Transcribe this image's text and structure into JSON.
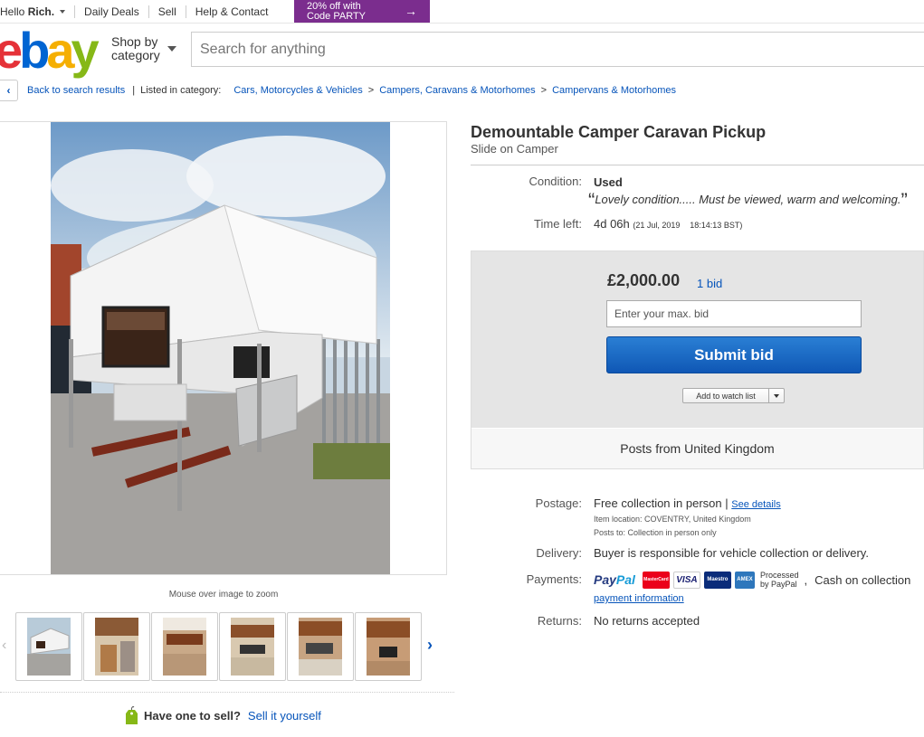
{
  "topbar": {
    "greeting_prefix": "Hello ",
    "user_name": "Rich.",
    "daily_deals": "Daily Deals",
    "sell": "Sell",
    "help": "Help & Contact",
    "promo_line1": "20% off with",
    "promo_line2": "Code PARTY",
    "promo_arrow": "→"
  },
  "header": {
    "logo": {
      "e": "e",
      "b": "b",
      "a": "a",
      "y": "y"
    },
    "shop_by_line1": "Shop by",
    "shop_by_line2": "category",
    "search_placeholder": "Search for anything"
  },
  "breadcrumb": {
    "back_icon": "‹",
    "back_label": "Back to search results",
    "listed_in": "Listed in category:",
    "items": [
      "Cars, Motorcycles & Vehicles",
      "Campers, Caravans & Motorhomes",
      "Campervans & Motorhomes"
    ],
    "separator": ">"
  },
  "gallery": {
    "zoom_note": "Mouse over image to zoom",
    "thumbnail_count": 6
  },
  "sell_prompt": {
    "question": "Have one to sell?",
    "link": "Sell it yourself"
  },
  "listing": {
    "title": "Demountable Camper Caravan Pickup",
    "subtitle": "Slide on Camper",
    "condition_label": "Condition:",
    "condition_value": "Used",
    "condition_quote": "Lovely condition..... Must be viewed, warm and welcoming.",
    "open_quote": "“",
    "close_quote": "”",
    "time_left_label": "Time left:",
    "time_left_value": "4d 06h",
    "end_date": "(21 Jul, 2019",
    "end_time": "18:14:13 BST)"
  },
  "bid": {
    "price": "£2,000.00",
    "bid_count": "1 bid",
    "max_bid_placeholder": "Enter your max. bid",
    "submit": "Submit bid",
    "watch": "Add to watch list",
    "posts_from": "Posts from United Kingdom"
  },
  "details": {
    "postage_label": "Postage:",
    "postage_value": "Free collection in person",
    "postage_sep": "|",
    "see_details": "See details",
    "item_location": "Item location:  COVENTRY, United Kingdom",
    "posts_to": "Posts to:  Collection in person only",
    "delivery_label": "Delivery:",
    "delivery_value": "Buyer is responsible for vehicle collection or delivery.",
    "payments_label": "Payments:",
    "paypal_1": "Pay",
    "paypal_2": "Pal",
    "card_mastercard": "MasterCard",
    "card_visa": "VISA",
    "card_maestro": "Maestro",
    "card_amex": "AMEX",
    "processed_1": "Processed",
    "processed_2": "by PayPal",
    "comma": ",",
    "cash": "Cash on collection",
    "payment_info": "payment information",
    "returns_label": "Returns:",
    "returns_value": "No returns accepted"
  },
  "colors": {
    "ebay_red": "#e53238",
    "ebay_blue": "#0064d2",
    "ebay_yellow": "#f5af02",
    "ebay_green": "#86b817",
    "link": "#0654ba",
    "promo": "#7b2d8e",
    "submit": "#0f57b5"
  }
}
